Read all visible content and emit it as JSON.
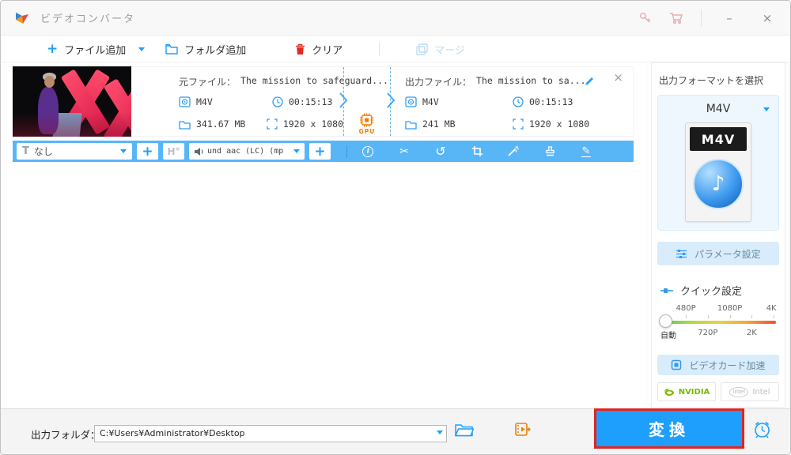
{
  "window": {
    "title": "ビデオコンバータ"
  },
  "icons": {
    "minimize": "–",
    "close": "×",
    "plus": "+",
    "info": "i",
    "cut": "✂",
    "rotate": "↺",
    "pen": "✎",
    "note": "♪",
    "text_tool": "T"
  },
  "toolbar": {
    "add_file": "ファイル追加",
    "add_folder": "フォルダ追加",
    "clear": "クリア",
    "merge": "マージ"
  },
  "file_card": {
    "source_label": "元ファイル：",
    "source_name": "The mission to safeguard...",
    "source_format": "M4V",
    "source_duration": "00:15:13",
    "source_size": "341.67 MB",
    "source_resolution": "1920 x 1080",
    "gpu_label": "GPU",
    "output_label": "出力ファイル：",
    "output_name": "The mission to sa...",
    "output_format": "M4V",
    "output_duration": "00:15:13",
    "output_size": "241 MB",
    "output_resolution": "1920 x 1080"
  },
  "edit_bar": {
    "subtitle_value": "なし",
    "hardsub_label": "H°",
    "audio_value": "und aac (LC) (mp"
  },
  "sidebar": {
    "format_title": "出力フォーマットを選択",
    "format_selected": "M4V",
    "format_icon_text": "M4V",
    "parameter_button": "パラメータ設定",
    "quick_title": "クイック設定",
    "slider_top": [
      "480P",
      "1080P",
      "4K"
    ],
    "slider_bottom": [
      "自動",
      "720P",
      "2K"
    ],
    "gpu_accel_button": "ビデオカード加速",
    "nvidia_label": "NVIDIA",
    "intel_logo": "intel",
    "intel_label": "Intel"
  },
  "bottom_bar": {
    "folder_label": "出力フォルダ：",
    "folder_path": "C:¥Users¥Administrator¥Desktop",
    "convert_label": "変換"
  },
  "colors": {
    "accent": "#1e9ffe",
    "edit_bar": "#58b6f7",
    "highlight_red": "#e2241d",
    "gpu_orange": "#f07c00",
    "nvidia_green": "#76b900"
  }
}
